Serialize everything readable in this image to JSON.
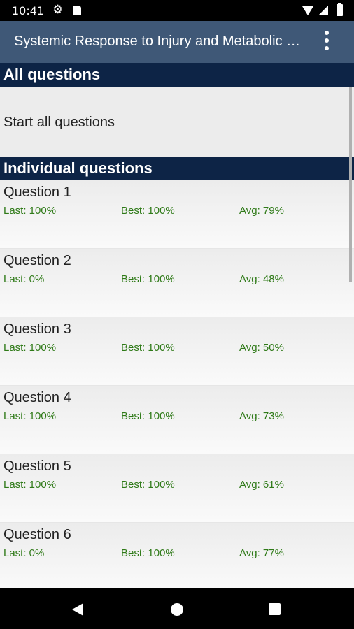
{
  "status_bar": {
    "time": "10:41",
    "icons": [
      "gear-icon",
      "sd-card-icon",
      "wifi-icon",
      "signal-icon",
      "battery-icon"
    ]
  },
  "app_bar": {
    "title": "Systemic Response to Injury and Metabolic Support",
    "menu_icon": "more-vert-icon"
  },
  "sections": {
    "all": {
      "header": "All questions",
      "start_label": "Start all questions"
    },
    "individual": {
      "header": "Individual questions"
    }
  },
  "questions": [
    {
      "title": "Question 1",
      "last": "Last: 100%",
      "best": "Best: 100%",
      "avg": "Avg: 79%"
    },
    {
      "title": "Question 2",
      "last": "Last: 0%",
      "best": "Best: 100%",
      "avg": "Avg: 48%"
    },
    {
      "title": "Question 3",
      "last": "Last: 100%",
      "best": "Best: 100%",
      "avg": "Avg: 50%"
    },
    {
      "title": "Question 4",
      "last": "Last: 100%",
      "best": "Best: 100%",
      "avg": "Avg: 73%"
    },
    {
      "title": "Question 5",
      "last": "Last: 100%",
      "best": "Best: 100%",
      "avg": "Avg: 61%"
    },
    {
      "title": "Question 6",
      "last": "Last: 0%",
      "best": "Best: 100%",
      "avg": "Avg: 77%"
    }
  ],
  "colors": {
    "app_bar": "#3f5877",
    "section_header": "#0d2446",
    "stat_text": "#2f7a18"
  },
  "nav_bar": {
    "icons": [
      "back-icon",
      "home-icon",
      "recents-icon"
    ]
  }
}
